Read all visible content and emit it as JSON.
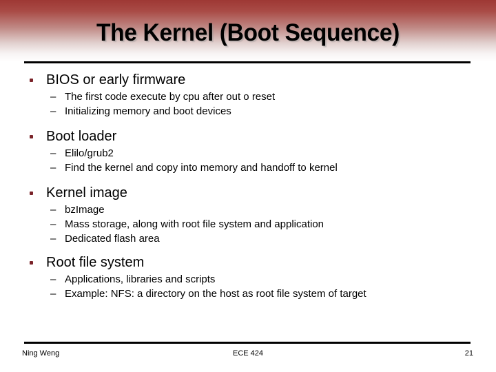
{
  "slide": {
    "title": "The Kernel (Boot Sequence)",
    "accent_color": "#9e3834",
    "bullet_color": "#7a2329",
    "text_color": "#000000",
    "background_color": "#ffffff"
  },
  "content": {
    "sections": [
      {
        "heading": "BIOS or early firmware",
        "items": [
          "The first code execute by cpu after out o reset",
          "Initializing memory and boot devices"
        ]
      },
      {
        "heading": "Boot loader",
        "items": [
          "Elilo/grub2",
          "Find the kernel and copy into memory and handoff to kernel"
        ]
      },
      {
        "heading": "Kernel image",
        "items": [
          "bzImage",
          "Mass storage, along with root file system and application",
          "Dedicated flash area"
        ]
      },
      {
        "heading": "Root file system",
        "items": [
          "Applications, libraries and scripts",
          "Example: NFS: a directory on the host as root file system of target"
        ]
      }
    ],
    "bullet_glyph_level1": "■",
    "bullet_glyph_level2": "–"
  },
  "footer": {
    "author": "Ning Weng",
    "course": "ECE 424",
    "page_number": "21"
  }
}
